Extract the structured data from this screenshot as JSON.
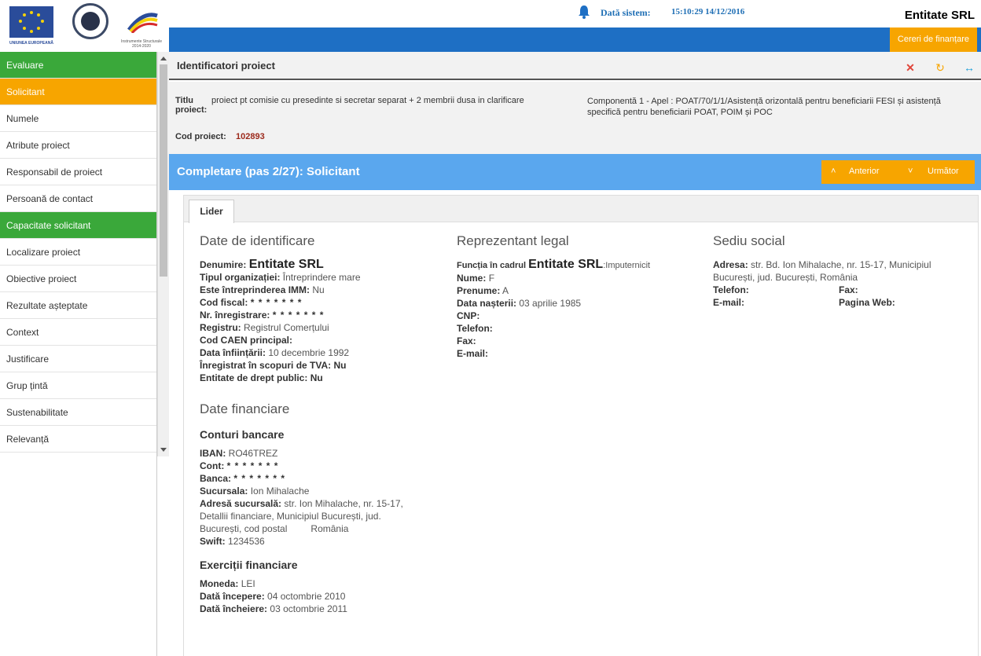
{
  "header": {
    "logo_eu_text": "UNIUNEA EUROPEANĂ",
    "logo_is_text": "Instrumente Structurale 2014-2020",
    "sys_label": "Dată sistem:",
    "sys_value": "15:10:29 14/12/2016",
    "entity": "Entitate SRL",
    "cereri_button": "Cereri de finanțare"
  },
  "sidebar": {
    "items": [
      {
        "label": "Evaluare"
      },
      {
        "label": "Solicitant"
      },
      {
        "label": "Numele"
      },
      {
        "label": "Atribute proiect"
      },
      {
        "label": "Responsabil de proiect"
      },
      {
        "label": "Persoană de contact"
      },
      {
        "label": "Capacitate solicitant"
      },
      {
        "label": "Localizare proiect"
      },
      {
        "label": "Obiective proiect"
      },
      {
        "label": "Rezultate așteptate"
      },
      {
        "label": "Context"
      },
      {
        "label": "Justificare"
      },
      {
        "label": "Grup țintă"
      },
      {
        "label": "Sustenabilitate"
      },
      {
        "label": "Relevanță"
      }
    ]
  },
  "ident": {
    "title": "Identificatori proiect",
    "titlu_label": "Titlu proiect:",
    "titlu_value": "proiect pt comisie cu presedinte si secretar separat + 2 membrii dusa in clarificare",
    "componenta": "Componentă 1 - Apel : POAT/70/1/1/Asistență orizontală pentru beneficiarii FESI și asistență specifică pentru beneficiarii POAT, POIM și POC",
    "cod_label": "Cod proiect:",
    "cod_value": "102893"
  },
  "step": {
    "title": "Completare (pas 2/27): Solicitant",
    "prev": "Anterior",
    "next": "Următor"
  },
  "tab": {
    "label": "Lider"
  },
  "identificare": {
    "title": "Date de identificare",
    "denumire_label": "Denumire:",
    "denumire_value": "Entitate SRL",
    "tip_label": "Tipul organizației:",
    "tip_value": "Întreprindere mare",
    "imm_label": "Este întreprinderea IMM:",
    "imm_value": "Nu",
    "codfiscal_label": "Cod fiscal:",
    "codfiscal_value": "* * * * * * *",
    "nrinreg_label": "Nr. înregistrare:",
    "nrinreg_value": "* * * * * * *",
    "registru_label": "Registru:",
    "registru_value": "Registrul Comerțului",
    "caen_label": "Cod CAEN principal:",
    "data_inf_label": "Data înființării:",
    "data_inf_value": "10 decembrie 1992",
    "tva_label": "Înregistrat în scopuri de TVA:",
    "tva_value": "Nu",
    "drept_label": "Entitate de drept public:",
    "drept_value": "Nu"
  },
  "financiare": {
    "title": "Date financiare",
    "conturi_title": "Conturi bancare",
    "iban_label": "IBAN:",
    "iban_value": "RO46TREZ",
    "cont_label": "Cont:",
    "cont_value": "* * * * * * *",
    "banca_label": "Banca:",
    "banca_value": "* * * * * * *",
    "sucursala_label": "Sucursala:",
    "sucursala_value": "Ion Mihalache",
    "adresa_label": "Adresă sucursală:",
    "adresa_value_1": "str. Ion Mihalache, nr. 15-17,",
    "adresa_value_2": "Detallii financiare, Municipiul București, jud.",
    "adresa_value_3": "București, cod postal",
    "adresa_value_4": "România",
    "swift_label": "Swift:",
    "swift_value": "1234536",
    "exercitii_title": "Exerciții financiare",
    "moneda_label": "Moneda:",
    "moneda_value": "LEI",
    "inceput_label": "Dată începere:",
    "inceput_value": "04 octombrie 2010",
    "incheiere_label": "Dată încheiere:",
    "incheiere_value": "03 octombrie 2011"
  },
  "reprezentant": {
    "title": "Reprezentant legal",
    "functia_label": "Funcția în cadrul",
    "functia_entity": "Entitate SRL",
    "functia_value": ":Imputernicit",
    "nume_label": "Nume:",
    "nume_value": "F",
    "prenume_label": "Prenume:",
    "prenume_value": "A",
    "nastere_label": "Data nașterii:",
    "nastere_value": "03 aprilie 1985",
    "cnp_label": "CNP:",
    "telefon_label": "Telefon:",
    "fax_label": "Fax:",
    "email_label": "E-mail:"
  },
  "sediu": {
    "title": "Sediu social",
    "adresa_label": "Adresa:",
    "adresa_value_1": "str. Bd. Ion Mihalache, nr. 15-17, Municipiul",
    "adresa_value_2": "București, jud. București, România",
    "telefon_label": "Telefon:",
    "fax_label": "Fax:",
    "email_label": "E-mail:",
    "web_label": "Pagina Web:"
  },
  "colors": {
    "green": "#3aa83a",
    "orange": "#f7a500",
    "blue": "#1e6fc4",
    "light_blue": "#5aa7ee"
  }
}
